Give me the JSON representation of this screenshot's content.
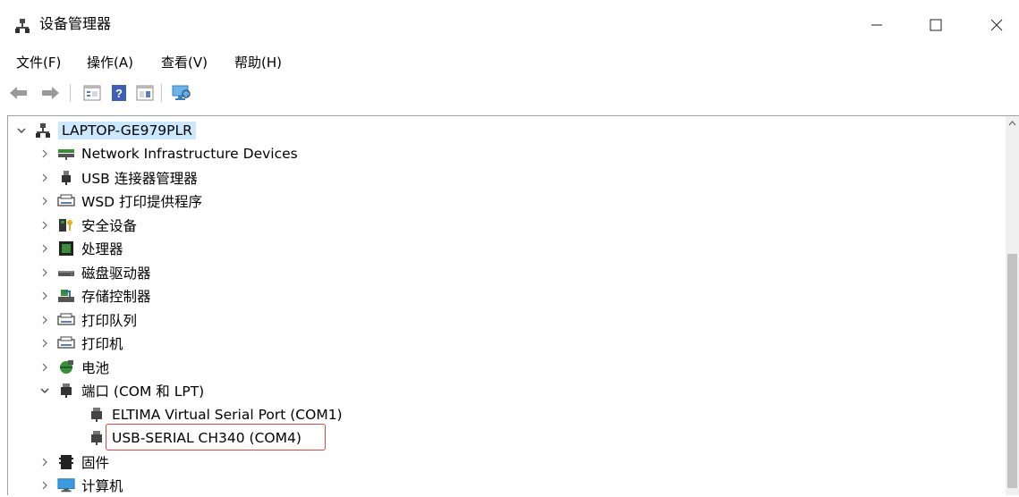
{
  "window": {
    "title": "设备管理器"
  },
  "menu": {
    "file": "文件(F)",
    "action": "操作(A)",
    "view": "查看(V)",
    "help": "帮助(H)"
  },
  "tree": {
    "root": "LAPTOP-GE979PLR",
    "items": [
      "Network Infrastructure Devices",
      "USB 连接器管理器",
      "WSD 打印提供程序",
      "安全设备",
      "处理器",
      "磁盘驱动器",
      "存储控制器",
      "打印队列",
      "打印机",
      "电池",
      "端口 (COM 和 LPT)",
      "固件",
      "计算机"
    ],
    "ports_children": [
      "ELTIMA Virtual Serial Port (COM1)",
      "USB-SERIAL CH340 (COM4)"
    ]
  },
  "colors": {
    "selection": "#cce8ff",
    "highlight_border": "#d9473f"
  }
}
